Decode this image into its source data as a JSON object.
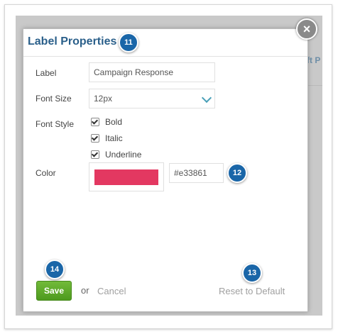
{
  "dialog": {
    "title": "Label Properties",
    "close_glyph": "×"
  },
  "background": {
    "peek_text": "ft P"
  },
  "form": {
    "label": {
      "caption": "Label",
      "value": "Campaign Response"
    },
    "font_size": {
      "caption": "Font Size",
      "value": "12px"
    },
    "font_style": {
      "caption": "Font Style",
      "options": [
        {
          "label": "Bold",
          "checked": true
        },
        {
          "label": "Italic",
          "checked": true
        },
        {
          "label": "Underline",
          "checked": true
        }
      ]
    },
    "color": {
      "caption": "Color",
      "value": "#e33861",
      "swatch_hex": "#e33861"
    }
  },
  "actions": {
    "save_label": "Save",
    "or_text": "or",
    "cancel_label": "Cancel",
    "reset_label": "Reset to Default"
  },
  "callouts": {
    "c11": "11",
    "c12": "12",
    "c13": "13",
    "c14": "14"
  }
}
